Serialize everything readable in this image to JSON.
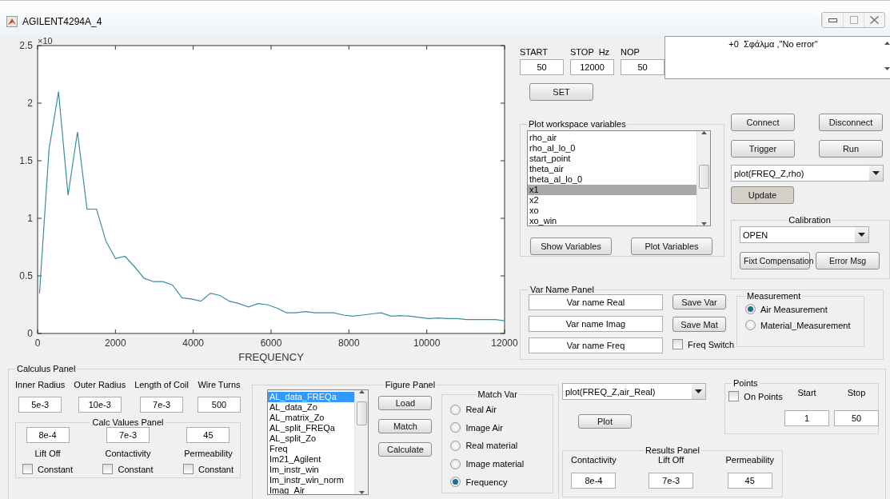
{
  "window": {
    "title": "AGILENT4294A_4"
  },
  "chart": {
    "y_multiplier": "×10",
    "chart_data": {
      "type": "line",
      "xlabel": "FREQUENCY",
      "xlim": [
        0,
        12000
      ],
      "ylim": [
        0,
        2.5
      ],
      "xticks": [
        0,
        2000,
        4000,
        6000,
        8000,
        10000,
        12000
      ],
      "yticks": [
        0,
        0.5,
        1,
        1.5,
        2,
        2.5
      ],
      "x": [
        50,
        294,
        538,
        782,
        1026,
        1270,
        1514,
        1758,
        2002,
        2246,
        2490,
        2734,
        2978,
        3222,
        3466,
        3710,
        3954,
        4198,
        4442,
        4686,
        4930,
        5174,
        5418,
        5662,
        5906,
        6150,
        6394,
        6638,
        6882,
        7126,
        7370,
        7614,
        7858,
        8102,
        8346,
        8590,
        8834,
        9078,
        9322,
        9566,
        9810,
        10054,
        10298,
        10542,
        10786,
        11030,
        11274,
        11518,
        11762,
        12000
      ],
      "series": [
        {
          "color": "#3a8ea0",
          "values": [
            0.35,
            1.6,
            2.1,
            1.2,
            1.75,
            1.08,
            1.08,
            0.8,
            0.65,
            0.67,
            0.58,
            0.48,
            0.45,
            0.45,
            0.42,
            0.31,
            0.3,
            0.28,
            0.35,
            0.33,
            0.28,
            0.26,
            0.23,
            0.26,
            0.25,
            0.22,
            0.18,
            0.18,
            0.19,
            0.18,
            0.18,
            0.18,
            0.16,
            0.15,
            0.16,
            0.17,
            0.18,
            0.15,
            0.155,
            0.15,
            0.14,
            0.13,
            0.135,
            0.13,
            0.13,
            0.12,
            0.12,
            0.12,
            0.12,
            0.11
          ]
        }
      ]
    }
  },
  "sweep": {
    "fields": [
      {
        "label": "START",
        "value": "50"
      },
      {
        "label": "STOP  Hz",
        "value": "12000"
      },
      {
        "label": "NOP",
        "value": "50"
      }
    ],
    "set_button": "SET"
  },
  "message_box": {
    "text": "+0  Σφάλμα ,\"No error\""
  },
  "workspace_panel": {
    "title": "Plot workspace variables",
    "items": [
      {
        "label": "rho_air",
        "selected": false
      },
      {
        "label": "rho_al_lo_0",
        "selected": false
      },
      {
        "label": "start_point",
        "selected": false
      },
      {
        "label": "theta_air",
        "selected": false
      },
      {
        "label": "theta_al_lo_0",
        "selected": false
      },
      {
        "label": "x1",
        "selected": true
      },
      {
        "label": "x2",
        "selected": false
      },
      {
        "label": "xo",
        "selected": false
      },
      {
        "label": "xo_win",
        "selected": false
      }
    ],
    "buttons": [
      "Show Variables",
      "Plot Variables"
    ]
  },
  "instrument_buttons": [
    "Connect",
    "Disconnect",
    "Trigger",
    "Run"
  ],
  "plot_select": {
    "value": "plot(FREQ_Z,rho)"
  },
  "update_button": "Update",
  "calibration": {
    "title": "Calibration",
    "select": {
      "value": "OPEN"
    },
    "buttons": [
      "Fixt Compensation",
      "Error Msg"
    ]
  },
  "var_name_panel": {
    "title": "Var Name  Panel",
    "fields": [
      {
        "value": "Var name Real"
      },
      {
        "value": "Var name Imag"
      },
      {
        "value": "Var name Freq"
      }
    ],
    "buttons": [
      "Save Var",
      "Save Mat"
    ],
    "checkbox": {
      "label": "Freq Switch",
      "checked": false
    },
    "measurement": {
      "title": "Measurement",
      "options": [
        {
          "label": "Air Measurement",
          "selected": true
        },
        {
          "label": "Material_Measurement",
          "selected": false
        }
      ]
    }
  },
  "calculus_panel": {
    "title": "Calculus Panel",
    "inputs": [
      {
        "label": "Inner Radius",
        "value": "5e-3"
      },
      {
        "label": "Outer Radius",
        "value": "10e-3"
      },
      {
        "label": "Length of Coil",
        "value": "7e-3"
      },
      {
        "label": "Wire Turns",
        "value": "500"
      }
    ],
    "calc_values": {
      "title": "Calc Values Panel",
      "items": [
        {
          "value": "8e-4",
          "label": "Lift Off",
          "checkbox": "Constant",
          "checked": false
        },
        {
          "value": "7e-3",
          "label": "Contactivity",
          "checkbox": "Constant",
          "checked": false
        },
        {
          "value": "45",
          "label": "Permeability",
          "checkbox": "Constant",
          "checked": false
        }
      ]
    }
  },
  "figure_panel": {
    "title": "Figure Panel",
    "items": [
      {
        "label": "AL_data_FREQa",
        "selected": true
      },
      {
        "label": "AL_data_Zo",
        "selected": false
      },
      {
        "label": "AL_matrix_Zo",
        "selected": false
      },
      {
        "label": "AL_split_FREQa",
        "selected": false
      },
      {
        "label": "AL_split_Zo",
        "selected": false
      },
      {
        "label": "Freq",
        "selected": false
      },
      {
        "label": "Im21_Agilent",
        "selected": false
      },
      {
        "label": "Im_instr_win",
        "selected": false
      },
      {
        "label": "Im_instr_win_norm",
        "selected": false
      },
      {
        "label": "Imag_Air",
        "selected": false
      }
    ],
    "buttons": [
      "Load",
      "Match",
      "Calculate"
    ],
    "match_var": {
      "title": "Match Var",
      "options": [
        {
          "label": "Real Air",
          "selected": false
        },
        {
          "label": "Image  Air",
          "selected": false
        },
        {
          "label": "Real material",
          "selected": false
        },
        {
          "label": "Image material",
          "selected": false
        },
        {
          "label": "Frequency",
          "selected": true
        }
      ]
    }
  },
  "result_plot_select": {
    "value": "plot(FREQ_Z,air_Real)"
  },
  "plot_button": "Plot",
  "points": {
    "title": "Points",
    "start_label": "Start",
    "stop_label": "Stop",
    "start": "1",
    "stop": "50",
    "on_points": {
      "label": "On Points",
      "checked": false
    }
  },
  "results_panel": {
    "title": "Results Panel",
    "items": [
      {
        "label": "Contactivity",
        "value": "8e-4"
      },
      {
        "label": "Lift Off",
        "value": "7e-3"
      },
      {
        "label": "Permeability",
        "value": "45"
      }
    ]
  }
}
